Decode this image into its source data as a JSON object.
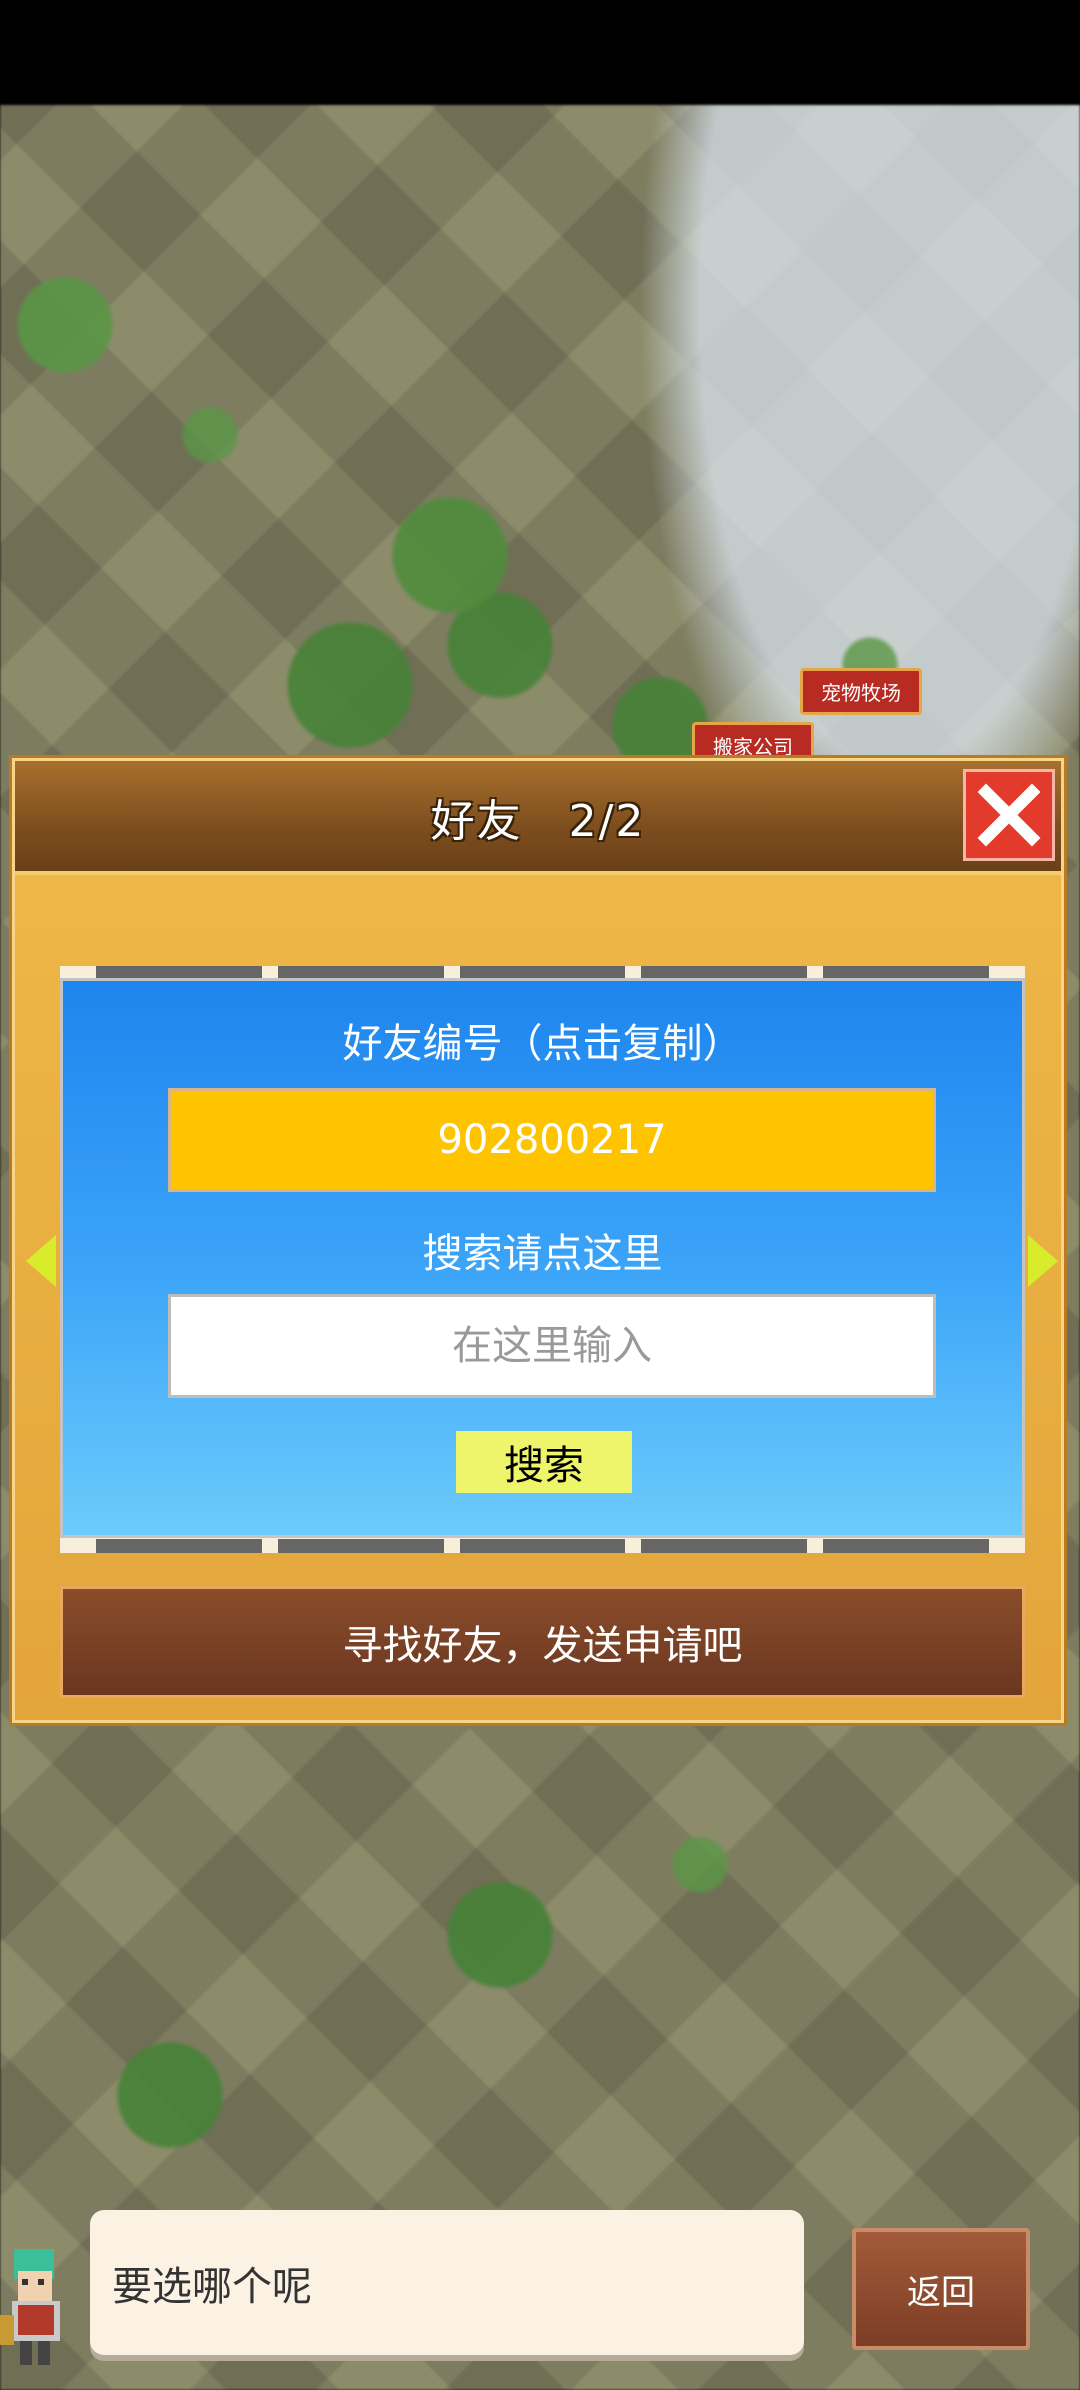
{
  "map": {
    "labels": [
      "宠物牧场",
      "搬家公司"
    ]
  },
  "dialog": {
    "title": "好友　2/2",
    "id_label": "好友编号（点击复制）",
    "friend_id": "902800217",
    "search_label": "搜索请点这里",
    "search_placeholder": "在这里输入",
    "search_button": "搜索",
    "send_request_button": "寻找好友，发送申请吧"
  },
  "bottom": {
    "message": "要选哪个呢",
    "back_button": "返回"
  },
  "colors": {
    "id_box": "#ffc400",
    "search_button": "#eef56a",
    "close_button": "#e23b2b",
    "nav_arrows": "#d8ec2c"
  }
}
